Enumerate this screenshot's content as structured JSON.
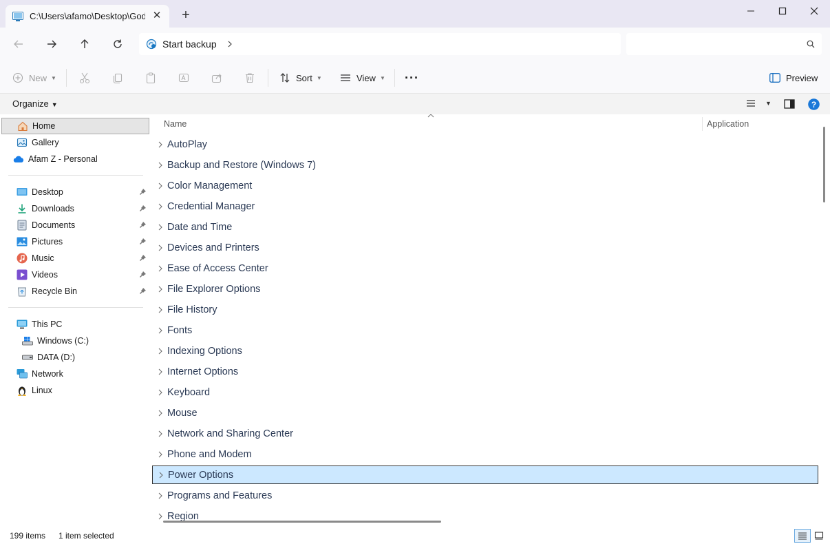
{
  "window": {
    "tab_title": "C:\\Users\\afamo\\Desktop\\God",
    "new_tab_symbol": "+",
    "close_tab_symbol": "✕"
  },
  "address": {
    "location": "Start backup",
    "search_placeholder": ""
  },
  "toolbar": {
    "new_label": "New",
    "sort_label": "Sort",
    "view_label": "View",
    "more_label": "···",
    "preview_label": "Preview"
  },
  "organize": {
    "label": "Organize"
  },
  "sidebar": {
    "quick": [
      {
        "label": "Home",
        "icon": "home-icon"
      },
      {
        "label": "Gallery",
        "icon": "gallery-icon"
      },
      {
        "label": "Afam Z - Personal",
        "icon": "onedrive-cloud-icon"
      }
    ],
    "pinned": [
      {
        "label": "Desktop",
        "icon": "desktop-folder-icon"
      },
      {
        "label": "Downloads",
        "icon": "downloads-icon"
      },
      {
        "label": "Documents",
        "icon": "documents-icon"
      },
      {
        "label": "Pictures",
        "icon": "pictures-icon"
      },
      {
        "label": "Music",
        "icon": "music-icon"
      },
      {
        "label": "Videos",
        "icon": "videos-icon"
      },
      {
        "label": "Recycle Bin",
        "icon": "recycle-bin-icon"
      }
    ],
    "devices": [
      {
        "label": "This PC",
        "icon": "this-pc-icon"
      },
      {
        "label": "Windows (C:)",
        "icon": "windows-drive-icon"
      },
      {
        "label": "DATA (D:)",
        "icon": "data-drive-icon"
      },
      {
        "label": "Network",
        "icon": "network-icon"
      },
      {
        "label": "Linux",
        "icon": "linux-penguin-icon"
      }
    ]
  },
  "columns": {
    "name": "Name",
    "application": "Application"
  },
  "items": [
    "AutoPlay",
    "Backup and Restore (Windows 7)",
    "Color Management",
    "Credential Manager",
    "Date and Time",
    "Devices and Printers",
    "Ease of Access Center",
    "File Explorer Options",
    "File History",
    "Fonts",
    "Indexing Options",
    "Internet Options",
    "Keyboard",
    "Mouse",
    "Network and Sharing Center",
    "Phone and Modem",
    "Power Options",
    "Programs and Features",
    "Region"
  ],
  "selected_item": "Power Options",
  "status": {
    "item_count": "199 items",
    "selection": "1 item selected"
  },
  "colors": {
    "accent": "#0067c0",
    "selection_bg": "#cce8ff",
    "tab_bar": "#e9e7f3"
  }
}
